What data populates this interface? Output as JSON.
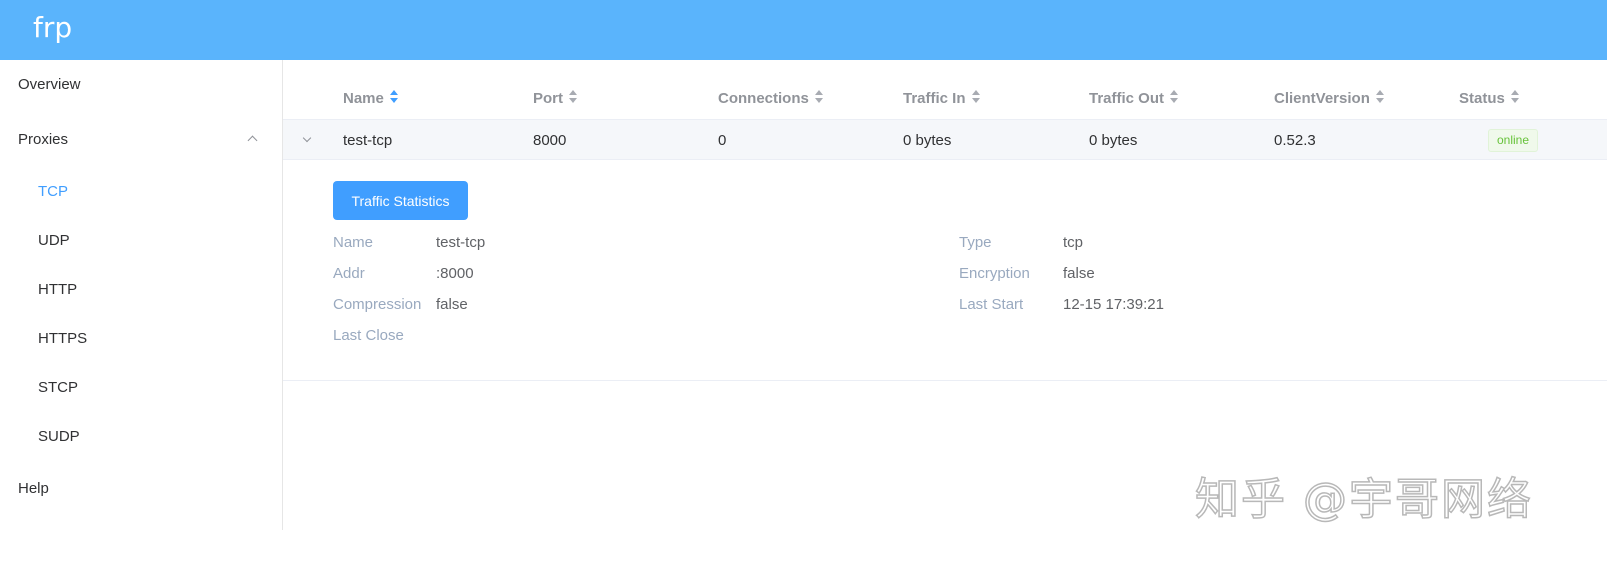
{
  "app": {
    "logo": "frp"
  },
  "sidebar": {
    "items": [
      {
        "label": "Overview"
      },
      {
        "label": "Proxies"
      },
      {
        "label": "TCP"
      },
      {
        "label": "UDP"
      },
      {
        "label": "HTTP"
      },
      {
        "label": "HTTPS"
      },
      {
        "label": "STCP"
      },
      {
        "label": "SUDP"
      },
      {
        "label": "Help"
      }
    ],
    "active_item": "TCP",
    "expanded_group": "Proxies"
  },
  "table": {
    "columns": [
      "Name",
      "Port",
      "Connections",
      "Traffic In",
      "Traffic Out",
      "ClientVersion",
      "Status"
    ],
    "sorted_column": "Name",
    "rows": [
      {
        "name": "test-tcp",
        "port": "8000",
        "connections": "0",
        "traffic_in": "0 bytes",
        "traffic_out": "0 bytes",
        "client_version": "0.52.3",
        "status": "online"
      }
    ]
  },
  "details": {
    "button_label": "Traffic Statistics",
    "left": [
      {
        "label": "Name",
        "value": "test-tcp"
      },
      {
        "label": "Addr",
        "value": ":8000"
      },
      {
        "label": "Compression",
        "value": "false"
      },
      {
        "label": "Last Close",
        "value": ""
      }
    ],
    "right": [
      {
        "label": "Type",
        "value": "tcp"
      },
      {
        "label": "Encryption",
        "value": "false"
      },
      {
        "label": "Last Start",
        "value": "12-15 17:39:21"
      }
    ]
  },
  "watermark": {
    "text": "知乎 @宇哥网络"
  },
  "colors": {
    "header": "#5ab4fc",
    "accent": "#409eff",
    "status_online": "#67c23a"
  }
}
